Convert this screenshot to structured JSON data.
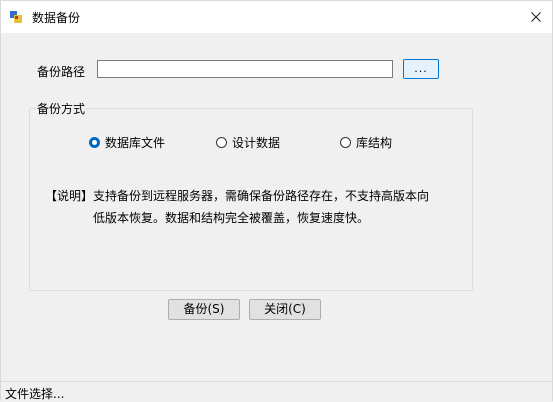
{
  "window": {
    "title": "数据备份"
  },
  "backup_path": {
    "label": "备份路径",
    "value": "",
    "browse_label": "..."
  },
  "backup_mode": {
    "group_title": "备份方式",
    "options": [
      {
        "label": "数据库文件",
        "checked": true
      },
      {
        "label": "设计数据",
        "checked": false
      },
      {
        "label": "库结构",
        "checked": false
      }
    ]
  },
  "note": {
    "line1": "【说明】支持备份到远程服务器，需确保备份路径存在，不支持高版本向",
    "line2": "低版本恢复。数据和结构完全被覆盖，恢复速度快。"
  },
  "buttons": {
    "backup": "备份(S)",
    "close": "关闭(C)"
  },
  "status": {
    "text": "文件选择..."
  }
}
